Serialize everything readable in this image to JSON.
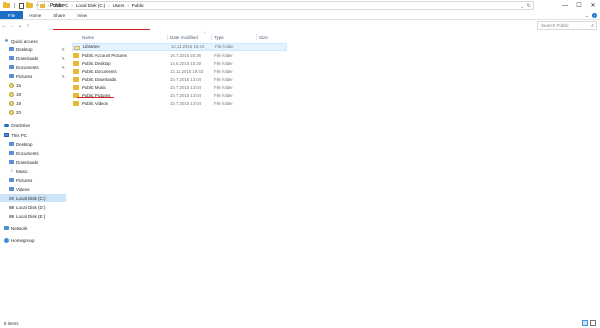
{
  "window": {
    "title": "Public",
    "controls": {
      "minimize": "—",
      "maximize": "☐",
      "close": "✕"
    }
  },
  "ribbon": {
    "tabs": [
      "File",
      "Home",
      "Share",
      "View"
    ],
    "expand_glyph": "⌄",
    "help_glyph": "?"
  },
  "address": {
    "back_glyph": "←",
    "forward_glyph": "→",
    "recent_glyph": "⌄",
    "up_glyph": "↑",
    "breadcrumbs": [
      "This PC",
      "Local Disk (C:)",
      "Users",
      "Public"
    ],
    "separator": "›",
    "refresh_glyph": "↻"
  },
  "search": {
    "placeholder": "Search Public",
    "icon": "search-icon"
  },
  "nav": {
    "items": [
      {
        "label": "Quick access",
        "icon": "star-icon",
        "pinned": false
      },
      {
        "label": "Desktop",
        "icon": "folder-icon",
        "pinned": true
      },
      {
        "label": "Downloads",
        "icon": "download-icon",
        "pinned": true
      },
      {
        "label": "Documents",
        "icon": "documents-icon",
        "pinned": true
      },
      {
        "label": "Pictures",
        "icon": "pictures-icon",
        "pinned": true
      },
      {
        "label": "15",
        "icon": "folder-icon",
        "pinned": false
      },
      {
        "label": "18",
        "icon": "folder-icon",
        "pinned": false
      },
      {
        "label": "19",
        "icon": "folder-icon",
        "pinned": false
      },
      {
        "label": "20",
        "icon": "folder-icon",
        "pinned": false
      },
      {
        "label": "OneDrive",
        "icon": "cloud-icon",
        "pinned": false
      },
      {
        "label": "This PC",
        "icon": "computer-icon",
        "pinned": false
      },
      {
        "label": "Desktop",
        "icon": "folder-icon",
        "pinned": false
      },
      {
        "label": "Documents",
        "icon": "documents-icon",
        "pinned": false
      },
      {
        "label": "Downloads",
        "icon": "download-icon",
        "pinned": false
      },
      {
        "label": "Music",
        "icon": "music-icon",
        "pinned": false
      },
      {
        "label": "Pictures",
        "icon": "pictures-icon",
        "pinned": false
      },
      {
        "label": "Videos",
        "icon": "videos-icon",
        "pinned": false
      },
      {
        "label": "Local Disk (C:)",
        "icon": "drive-icon",
        "pinned": false,
        "selected": true
      },
      {
        "label": "Local Disk (D:)",
        "icon": "drive-icon",
        "pinned": false
      },
      {
        "label": "Local Disk (E:)",
        "icon": "drive-icon",
        "pinned": false
      },
      {
        "label": "Network",
        "icon": "network-icon",
        "pinned": false
      },
      {
        "label": "Homegroup",
        "icon": "homegroup-icon",
        "pinned": false
      }
    ],
    "pin_glyph": "✎"
  },
  "columns": [
    "Name",
    "Date modified",
    "Type",
    "Size"
  ],
  "sort_caret": "^",
  "files": [
    {
      "name": "Libraries",
      "date": "12.11.2015 19:43",
      "type": "File folder",
      "kind": "library"
    },
    {
      "name": "Public Account Pictures",
      "date": "16.7.2016 20:36",
      "type": "File folder",
      "kind": "folder"
    },
    {
      "name": "Public Desktop",
      "date": "14.5.2016 15:30",
      "type": "File folder",
      "kind": "folder",
      "highlight": true
    },
    {
      "name": "Public Documents",
      "date": "12.11.2015 19:43",
      "type": "File folder",
      "kind": "folder"
    },
    {
      "name": "Public Downloads",
      "date": "10.7.2015 13:04",
      "type": "File folder",
      "kind": "folder"
    },
    {
      "name": "Public Music",
      "date": "10.7.2015 13:04",
      "type": "File folder",
      "kind": "folder"
    },
    {
      "name": "Public Pictures",
      "date": "10.7.2015 13:04",
      "type": "File folder",
      "kind": "folder"
    },
    {
      "name": "Public Videos",
      "date": "10.7.2015 13:04",
      "type": "File folder",
      "kind": "folder"
    }
  ],
  "status": {
    "text": "8 items"
  },
  "colors": {
    "accent": "#1a6fc4",
    "selection": "#cce4f7",
    "folder": "#e8b933",
    "annotation_red": "#d42020"
  }
}
